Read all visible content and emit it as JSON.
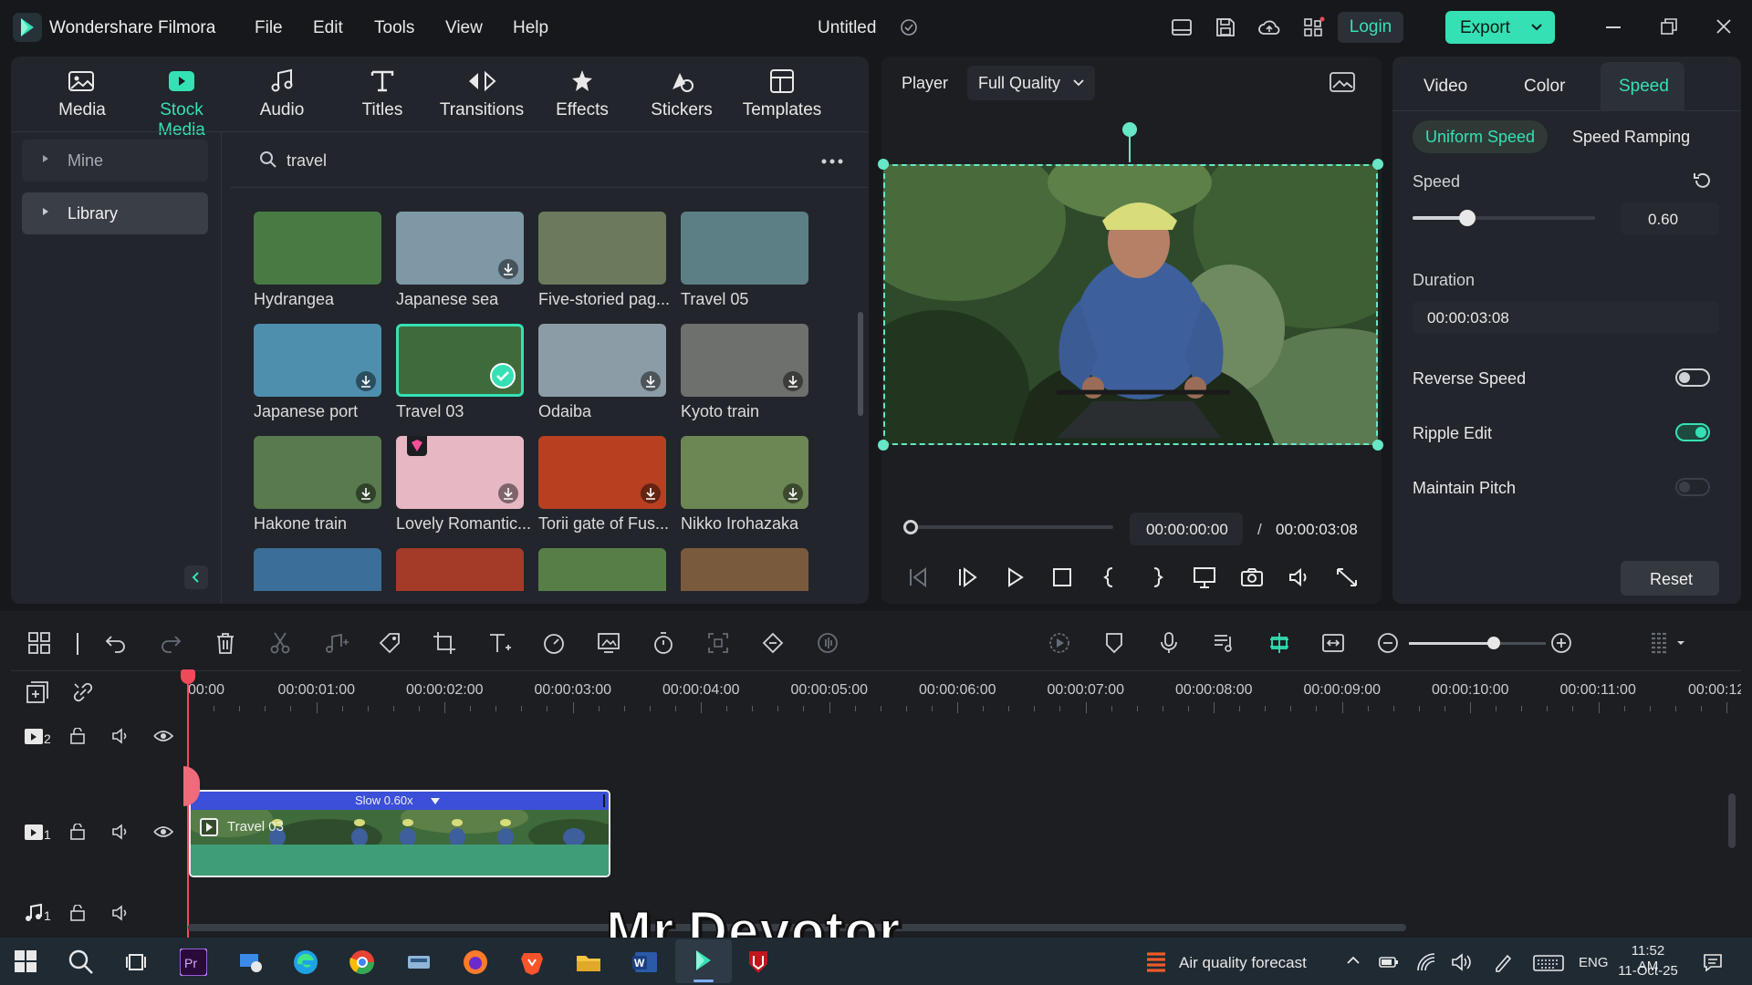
{
  "app": {
    "name": "Wondershare Filmora",
    "menu": [
      "File",
      "Edit",
      "Tools",
      "View",
      "Help"
    ],
    "project_title": "Untitled",
    "login_label": "Login",
    "export_label": "Export"
  },
  "media_tabs": [
    {
      "label": "Media",
      "icon": "media-icon"
    },
    {
      "label": "Stock Media",
      "icon": "stock-media-icon",
      "active": true
    },
    {
      "label": "Audio",
      "icon": "music-note-icon"
    },
    {
      "label": "Titles",
      "icon": "titles-icon"
    },
    {
      "label": "Transitions",
      "icon": "transitions-icon"
    },
    {
      "label": "Effects",
      "icon": "effects-icon"
    },
    {
      "label": "Stickers",
      "icon": "stickers-icon"
    },
    {
      "label": "Templates",
      "icon": "templates-icon"
    }
  ],
  "sidebar": {
    "items": [
      {
        "label": "Mine"
      },
      {
        "label": "Library",
        "selected": true
      }
    ]
  },
  "search": {
    "value": "travel"
  },
  "stock_items": [
    {
      "label": "Hydrangea",
      "bg": "#4a7a44"
    },
    {
      "label": "Japanese sea",
      "bg": "#7f98a6"
    },
    {
      "label": "Five-storied pag...",
      "bg": "#6b7a5d"
    },
    {
      "label": "Travel 05",
      "bg": "#5c7f86"
    },
    {
      "label": "Japanese port",
      "bg": "#4f8fae"
    },
    {
      "label": "Travel 03",
      "bg": "#3f6b3c",
      "selected": true
    },
    {
      "label": "Odaiba",
      "bg": "#8c9ca6"
    },
    {
      "label": "Kyoto train",
      "bg": "#6d706c"
    },
    {
      "label": "Hakone train",
      "bg": "#587a4e"
    },
    {
      "label": "Lovely Romantic...",
      "bg": "#e7b8c4"
    },
    {
      "label": "Torii gate of Fus...",
      "bg": "#b84021"
    },
    {
      "label": "Nikko Irohazaka",
      "bg": "#6c8654"
    },
    {
      "label": "",
      "bg": "#3b6e98"
    },
    {
      "label": "",
      "bg": "#a43a28"
    },
    {
      "label": "",
      "bg": "#587e47"
    },
    {
      "label": "",
      "bg": "#7a5a3c"
    }
  ],
  "player": {
    "label": "Player",
    "quality": "Full Quality",
    "current_time": "00:00:00:00",
    "separator": "/",
    "total_time": "00:00:03:08"
  },
  "props": {
    "tabs": [
      "Video",
      "Color",
      "Speed"
    ],
    "active_tab": "Speed",
    "subtabs": [
      "Uniform Speed",
      "Speed Ramping"
    ],
    "speed_label": "Speed",
    "speed_value": "0.60",
    "speed_fraction": 0.3,
    "duration_label": "Duration",
    "duration_value": "00:00:03:08",
    "reverse_label": "Reverse Speed",
    "reverse_on": false,
    "ripple_label": "Ripple Edit",
    "ripple_on": true,
    "pitch_label": "Maintain Pitch",
    "pitch_on": false,
    "reset_label": "Reset"
  },
  "timeline": {
    "ruler": [
      "00:00",
      "00:00:01:00",
      "00:00:02:00",
      "00:00:03:00",
      "00:00:04:00",
      "00:00:05:00",
      "00:00:06:00",
      "00:00:07:00",
      "00:00:08:00",
      "00:00:09:00",
      "00:00:10:00",
      "00:00:11:00",
      "00:00:12"
    ],
    "tracks": [
      {
        "number": "2",
        "type": "video"
      },
      {
        "number": "1",
        "type": "video"
      },
      {
        "number": "1",
        "type": "audio"
      }
    ],
    "clip": {
      "name": "Travel 03",
      "speed_label": "Slow 0.60x"
    }
  },
  "watermark": "Mr.Devotor",
  "taskbar": {
    "weather": "Air quality forecast",
    "lang": "ENG",
    "time": "11:52 AM",
    "date": "11-Oct-25"
  },
  "colors": {
    "accent": "#35e1b4",
    "panel": "#22252b",
    "clip_header": "#3b4fd8",
    "clip_body": "#3f9e78",
    "playhead": "#ef4a5a"
  }
}
